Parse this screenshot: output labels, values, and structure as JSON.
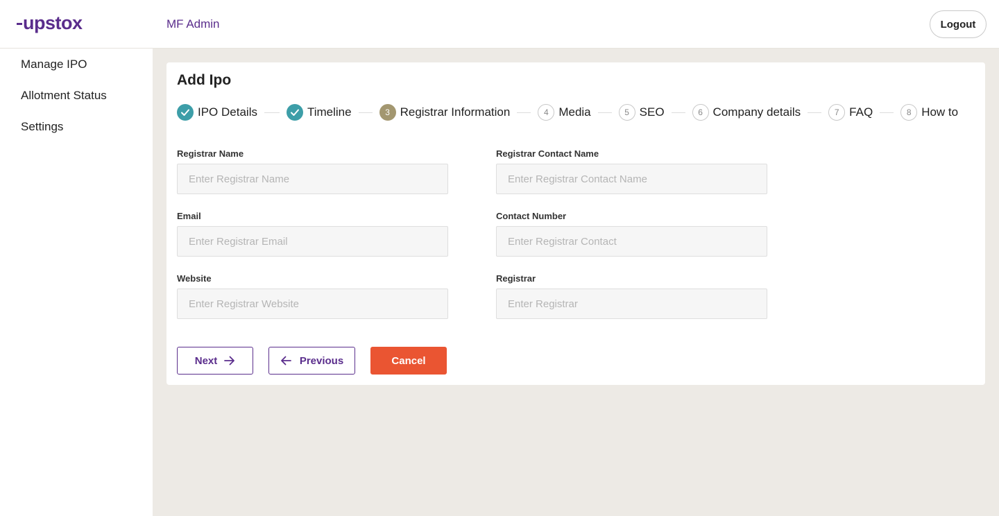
{
  "header": {
    "logo_text": "upstox",
    "app_title": "MF Admin",
    "logout_label": "Logout"
  },
  "sidebar": {
    "items": [
      {
        "label": "Manage IPO"
      },
      {
        "label": "Allotment Status"
      },
      {
        "label": "Settings"
      }
    ]
  },
  "page": {
    "title": "Add Ipo"
  },
  "stepper": {
    "steps": [
      {
        "number": "1",
        "label": "IPO Details",
        "state": "done"
      },
      {
        "number": "2",
        "label": "Timeline",
        "state": "done"
      },
      {
        "number": "3",
        "label": "Registrar Information",
        "state": "active"
      },
      {
        "number": "4",
        "label": "Media",
        "state": "todo"
      },
      {
        "number": "5",
        "label": "SEO",
        "state": "todo"
      },
      {
        "number": "6",
        "label": "Company details",
        "state": "todo"
      },
      {
        "number": "7",
        "label": "FAQ",
        "state": "todo"
      },
      {
        "number": "8",
        "label": "How to",
        "state": "todo"
      }
    ]
  },
  "form": {
    "registrar_name": {
      "label": "Registrar Name",
      "placeholder": "Enter Registrar Name",
      "value": ""
    },
    "registrar_contact_name": {
      "label": "Registrar Contact Name",
      "placeholder": "Enter Registrar Contact Name",
      "value": ""
    },
    "email": {
      "label": "Email",
      "placeholder": "Enter Registrar Email",
      "value": ""
    },
    "contact_number": {
      "label": "Contact Number",
      "placeholder": "Enter Registrar Contact",
      "value": ""
    },
    "website": {
      "label": "Website",
      "placeholder": "Enter Registrar Website",
      "value": ""
    },
    "registrar": {
      "label": "Registrar",
      "placeholder": "Enter Registrar",
      "value": ""
    }
  },
  "actions": {
    "next_label": "Next",
    "previous_label": "Previous",
    "cancel_label": "Cancel"
  },
  "colors": {
    "brand": "#5a2d8c",
    "step_done": "#3d9ea8",
    "step_active": "#a39770",
    "cancel": "#ea5532",
    "background": "#edeae5"
  },
  "icons": {
    "step_done": "check-icon",
    "next": "arrow-right-icon",
    "previous": "arrow-left-icon"
  }
}
